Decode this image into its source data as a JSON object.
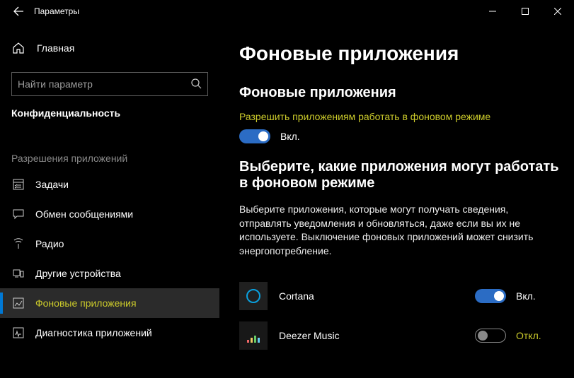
{
  "window": {
    "title": "Параметры"
  },
  "sidebar": {
    "home": "Главная",
    "search_placeholder": "Найти параметр",
    "category": "Конфиденциальность",
    "group": "Разрешения приложений",
    "items": [
      {
        "label": "Задачи",
        "icon": "tasks-icon",
        "active": false
      },
      {
        "label": "Обмен сообщениями",
        "icon": "messaging-icon",
        "active": false
      },
      {
        "label": "Радио",
        "icon": "radio-icon",
        "active": false
      },
      {
        "label": "Другие устройства",
        "icon": "other-devices-icon",
        "active": false
      },
      {
        "label": "Фоновые приложения",
        "icon": "background-apps-icon",
        "active": true
      },
      {
        "label": "Диагностика приложений",
        "icon": "diagnostics-icon",
        "active": false
      }
    ]
  },
  "page": {
    "title": "Фоновые приложения",
    "section1_title": "Фоновые приложения",
    "master_label": "Разрешить приложениям работать в фоновом режиме",
    "master_state": "Вкл.",
    "master_on": true,
    "section2_title": "Выберите, какие приложения могут работать в фоновом режиме",
    "description": "Выберите приложения, которые могут получать сведения, отправлять уведомления и обновляться, даже если вы их не используете. Выключение фоновых приложений может снизить энергопотребление.",
    "apps": [
      {
        "name": "Cortana",
        "icon": "cortana-icon",
        "on": true,
        "state": "Вкл."
      },
      {
        "name": "Deezer Music",
        "icon": "deezer-icon",
        "on": false,
        "state": "Откл."
      }
    ]
  }
}
